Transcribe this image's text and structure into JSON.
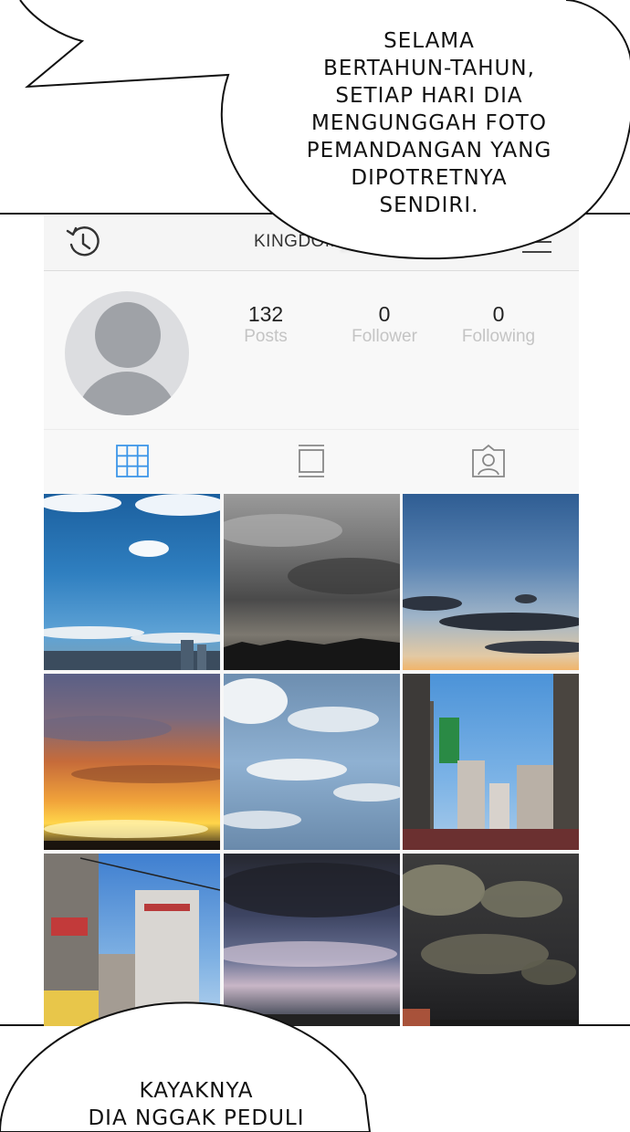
{
  "bubble_top": {
    "lines": [
      "SELAMA",
      "BERTAHUN-TAHUN,",
      "SETIAP HARI DIA",
      "MENGUNGGAH FOTO",
      "PEMANDANGAN YANG",
      "DIPOTRETNYA",
      "SENDIRI."
    ]
  },
  "bubble_bottom": {
    "lines": [
      "KAYAKNYA",
      "DIA NGGAK PEDULI"
    ]
  },
  "app": {
    "header_title": "KINGDOM",
    "icons": {
      "history": "history-icon",
      "dropdown": "chevron-down-icon",
      "menu": "hamburger-menu-icon"
    },
    "stats": [
      {
        "value": "132",
        "label": "Posts"
      },
      {
        "value": "0",
        "label": "Follower"
      },
      {
        "value": "0",
        "label": "Following"
      }
    ],
    "tabs": [
      "grid-view-icon",
      "feed-view-icon",
      "tagged-photos-icon"
    ],
    "accent_color": "#3d96e8",
    "photos": [
      "blue sky with white clouds over city skyline",
      "grey overcast sky over tree line",
      "blue evening sky with dark clouds",
      "orange sunset with purple clouds",
      "blue sky with scattered clouds",
      "city street with signs and buildings",
      "tall buildings under blue sky",
      "dark stormy clouds",
      "night sky with grey clouds"
    ]
  }
}
